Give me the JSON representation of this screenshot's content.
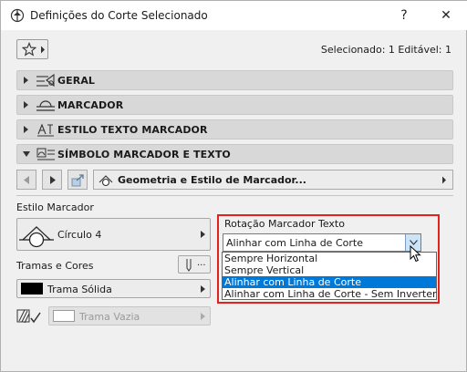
{
  "window": {
    "title": "Definições do Corte Selecionado",
    "help_glyph": "?",
    "close_glyph": "✕"
  },
  "header": {
    "selected_info": "Selecionado: 1 Editável: 1"
  },
  "sections": [
    {
      "label": "GERAL",
      "expanded": false
    },
    {
      "label": "MARCADOR",
      "expanded": false
    },
    {
      "label": "ESTILO TEXTO MARCADOR",
      "expanded": false
    },
    {
      "label": "SÍMBOLO MARCADOR E TEXTO",
      "expanded": true
    }
  ],
  "subpanel": {
    "field_label": "Geometria e Estilo de Marcador..."
  },
  "left": {
    "estilo_label": "Estilo Marcador",
    "marker_value": "Círculo 4",
    "tramas_label": "Tramas e Cores",
    "pen_button_label": "...",
    "fill_value": "Trama Sólida",
    "fill2_value": "Trama Vazia"
  },
  "right": {
    "rotation_label": "Rotação Marcador Texto",
    "combo_value": "Alinhar com Linha de Corte",
    "options": [
      "Sempre Horizontal",
      "Sempre Vertical",
      "Alinhar com Linha de Corte",
      "Alinhar com Linha de Corte - Sem Inverter"
    ],
    "selected_option_index": 2
  },
  "colors": {
    "highlight": "#0078d7",
    "callout": "#e3211f",
    "section_bg": "#d8d8d8"
  }
}
